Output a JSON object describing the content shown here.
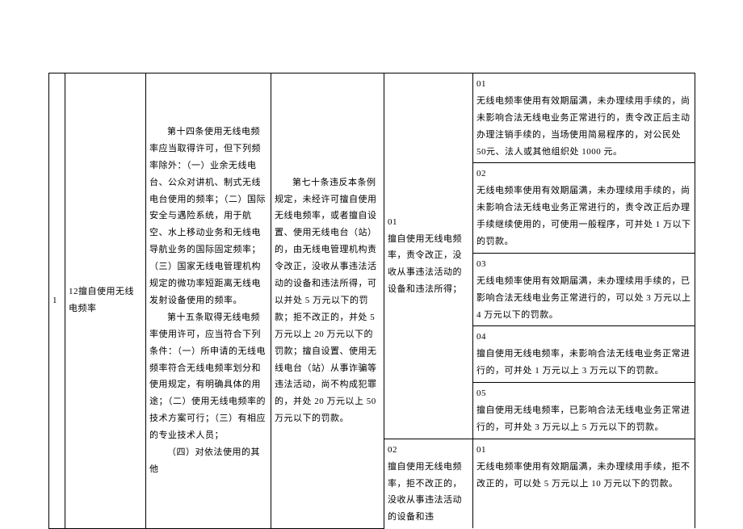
{
  "row_index": "1",
  "col2_number": "12",
  "col2_title": "擅自使用无线电频率",
  "col3_text_p1": "第十四条使用无线电频率应当取得许可，但下列频率除外：（一）业余无线电台、公众对讲机、制式无线电台使用的频率；（二）国际安全与遇险系统，用于航空、水上移动业务和无线电导航业务的国际固定频率；（三）国家无线电管理机构规定的微功率短距离无线电发射设备使用的频率。",
  "col3_text_p2": "第十五条取得无线电频率使用许可，应当符合下列条件：（一）所申请的无线电频率符合无线电频率划分和使用规定，有明确具体的用途；（二）使用无线电频率的技术方案可行；（三）有相应的专业技术人员；",
  "col3_text_p3": "（四）对依法使用的其他",
  "col4_text": "第七十条违反本条例规定，未经许可擅自使用无线电频率，或者擅自设置、使用无线电台（站）的，由无线电管理机构责令改正，没收从事违法活动的设备和违法所得，可以并处 5 万元以下的罚款；拒不改正的，并处 5 万元以上 20 万元以下的罚款；擅自设置、使用无线电台（站）从事诈骗等违法活动，尚不构成犯罪的，并处 20 万元以上 50 万元以下的罚款。",
  "col5_block1_num": "01",
  "col5_block1_text": "擅自使用无线电频率，责令改正，没收从事违法活动的设备和违法所得；",
  "col5_block2_num": "02",
  "col5_block2_text": "擅自使用无线电频率，拒不改正的，没收从事违法活动的设备和违",
  "col6_r1_num": "01",
  "col6_r1_text": "无线电频率使用有效期届满，未办理续用手续的，尚未影响合法无线电业务正常进行的，责令改正后主动办理注销手续的，当场使用简易程序的，对公民处 50元、法人或其他组织处 1000 元。",
  "col6_r2_num": "02",
  "col6_r2_text": "无线电频率使用有效期届满，未办理续用手续的，尚未影响合法无线电业务正常进行的，责令改正后办理手续继续使用的，可使用一般程序，可并处 1 万以下的罚款。",
  "col6_r3_num": "03",
  "col6_r3_text": "无线电频率使用有效期届满，未办理续用手续的，已影响合法无线电业务正常进行的，可以处 3 万元以上 4 万元以下的罚款。",
  "col6_r4_num": "04",
  "col6_r4_text": "擅自使用无线电频率，未影响合法无线电业务正常进行的，可并处 1 万元以上 3 万元以下的罚款。",
  "col6_r5_num": "05",
  "col6_r5_text": "擅自使用无线电频率，已影响合法无线电业务正常进行的，可并处 3 万元以上 5 万元以下的罚款。",
  "col6_r6_num": "01",
  "col6_r6_text": "无线电频率使用有效期届满，未办理续用手续，拒不改正的，可以处 5 万元以上 10 万元以下的罚款。"
}
